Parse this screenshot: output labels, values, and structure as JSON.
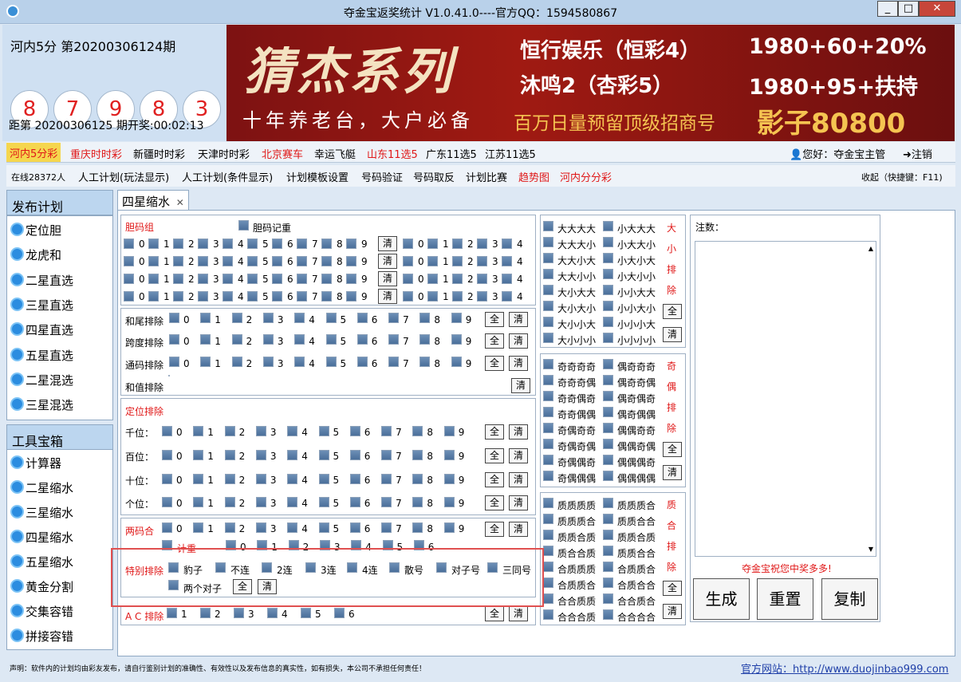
{
  "window": {
    "title": "夺金宝返奖统计  V1.0.41.0----官方QQ：1594580867",
    "min": "_",
    "max": "□",
    "close": "✕"
  },
  "lottery": {
    "name_period": "河内5分  第20200306124期",
    "balls": [
      "8",
      "7",
      "9",
      "8",
      "3"
    ],
    "next_draw": "距第 20200306125 期开奖:00:02:13"
  },
  "banner": {
    "title": "猜杰系列",
    "slogan": "十年养老台，大户必备",
    "ad1_left": "恒行娱乐（恒彩4）",
    "ad1_right": "1980+60+20%",
    "ad2_left": "沐鸣2（杏彩5）",
    "ad2_right": "1980+95+扶持",
    "ad3_left": "百万日量预留顶级招商号",
    "ad3_right": "影子80800"
  },
  "nav1": {
    "items": [
      "河内5分彩",
      "重庆时时彩",
      "新疆时时彩",
      "天津时时彩",
      "北京赛车",
      "幸运飞艇",
      "山东11选5",
      "广东11选5",
      "江苏11选5"
    ],
    "greeting": "您好：夺金宝主管",
    "logout": "注销"
  },
  "nav2": {
    "online": "在线28372人",
    "items": [
      "人工计划(玩法显示)",
      "人工计划(条件显示)",
      "计划模板设置",
      "号码验证",
      "号码取反",
      "计划比赛",
      "趋势图",
      "河内分分彩"
    ],
    "collapse": "收起（快捷键：F11)"
  },
  "sidebar": {
    "plan_title": "发布计划",
    "plan_items": [
      "定位胆",
      "龙虎和",
      "二星直选",
      "三星直选",
      "四星直选",
      "五星直选",
      "二星混选",
      "三星混选"
    ],
    "tools_title": "工具宝箱",
    "tool_items": [
      "计算器",
      "二星缩水",
      "三星缩水",
      "四星缩水",
      "五星缩水",
      "黄金分割",
      "交集容错",
      "拼接容错"
    ]
  },
  "tab": {
    "label": "四星缩水",
    "close": "✕"
  },
  "filters": {
    "dan_group": "胆码组",
    "dan_record": "胆码记重",
    "digits": [
      "0",
      "1",
      "2",
      "3",
      "4",
      "5",
      "6",
      "7",
      "8",
      "9"
    ],
    "digits_short": [
      "0",
      "1",
      "2",
      "3",
      "4"
    ],
    "all": "全",
    "clear": "清",
    "sum_tail": "和尾排除",
    "span": "跨度排除",
    "common": "通码排除",
    "sum_value": "和值排除",
    "position_excl": "定位排除",
    "positions": [
      "千位：",
      "百位：",
      "十位：",
      "个位："
    ],
    "two_combo": "两码合",
    "count_repeat": "计重",
    "count_digits": [
      "0",
      "1",
      "2",
      "3",
      "4",
      "5",
      "6"
    ],
    "special": "特别排除",
    "special_items": [
      "豹子",
      "不连",
      "2连",
      "3连",
      "4连",
      "散号",
      "对子号",
      "三同号"
    ],
    "two_pairs": "两个对子",
    "ac": "A C 排除",
    "ac_digits": [
      "1",
      "2",
      "3",
      "4",
      "5",
      "6"
    ]
  },
  "size_group": {
    "left": [
      "大大大大",
      "大大大小",
      "大大小大",
      "大大小小",
      "大小大大",
      "大小大小",
      "大小小大",
      "大小小小"
    ],
    "right": [
      "小大大大",
      "小大大小",
      "小大小大",
      "小大小小",
      "小小大大",
      "小小大小",
      "小小小大",
      "小小小小"
    ],
    "label": [
      "大",
      "小",
      "排",
      "除"
    ]
  },
  "parity_group": {
    "left": [
      "奇奇奇奇",
      "奇奇奇偶",
      "奇奇偶奇",
      "奇奇偶偶",
      "奇偶奇奇",
      "奇偶奇偶",
      "奇偶偶奇",
      "奇偶偶偶"
    ],
    "right": [
      "偶奇奇奇",
      "偶奇奇偶",
      "偶奇偶奇",
      "偶奇偶偶",
      "偶偶奇奇",
      "偶偶奇偶",
      "偶偶偶奇",
      "偶偶偶偶"
    ],
    "label": [
      "奇",
      "偶",
      "排",
      "除"
    ]
  },
  "prime_group": {
    "left": [
      "质质质质",
      "质质质合",
      "质质合质",
      "质合合质",
      "合质质质",
      "合质质合",
      "合合质质",
      "合合合质"
    ],
    "right": [
      "质质质合",
      "质质合合",
      "质质合质",
      "质质合合",
      "合质质合",
      "合质合合",
      "合合质合",
      "合合合合"
    ],
    "label": [
      "质",
      "合",
      "排",
      "除"
    ]
  },
  "notes": {
    "label": "注数：",
    "wish": "夺金宝祝您中奖多多!",
    "generate": "生成",
    "reset": "重置",
    "copy": "复制"
  },
  "footer": {
    "disclaimer": "声明：软件内的计划均由彩友发布，请自行鉴别计划的准确性、有效性以及发布信息的真实性，如有损失，本公司不承担任何责任！",
    "website": "官方网站：http://www.duojinbao999.com"
  },
  "colors": {
    "accent_red": "#e01818",
    "link_blue": "#1f3fa8",
    "highlight_box": "#e05050"
  }
}
